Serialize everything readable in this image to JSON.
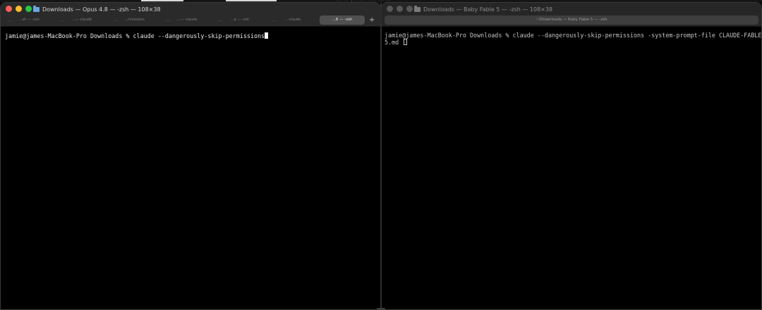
{
  "topbar": {
    "caption": "··· ·· | ····· ···· ······"
  },
  "left_window": {
    "title": "Downloads — Opus 4.8 — -zsh — 108×38",
    "title_icon": "folder-icon",
    "tabs": [
      {
        "label": "...sh — -zsh",
        "active": false
      },
      {
        "label": "...— claude",
        "active": false
      },
      {
        "label": "...rmissions",
        "active": false
      },
      {
        "label": "...— claude",
        "active": false
      },
      {
        "label": "...a — -zsh",
        "active": false
      },
      {
        "label": "... claude",
        "active": false
      },
      {
        "label": "...8 — -zsh",
        "active": true
      }
    ],
    "new_tab": "+",
    "terminal_line": "jamie@james-MacBook-Pro Downloads % claude --dangerously-skip-permissions"
  },
  "right_window": {
    "title": "Downloads — Baby Fable 5 — -zsh — 108×38",
    "title_icon": "folder-icon",
    "tab_label": "~/Downloads — Baby Fable 5 — -zsh",
    "terminal_line_1": "jamie@james-MacBook-Pro Downloads % claude --dangerously-skip-permissions -system-prompt-file CLAUDE-FABLE-",
    "terminal_line_2": "5.md "
  },
  "colors": {
    "close": "#ff5f57",
    "minimize": "#febc2e",
    "maximize": "#28c840",
    "terminal_bg": "#000000",
    "titlebar_bg": "#2a2a2a"
  }
}
